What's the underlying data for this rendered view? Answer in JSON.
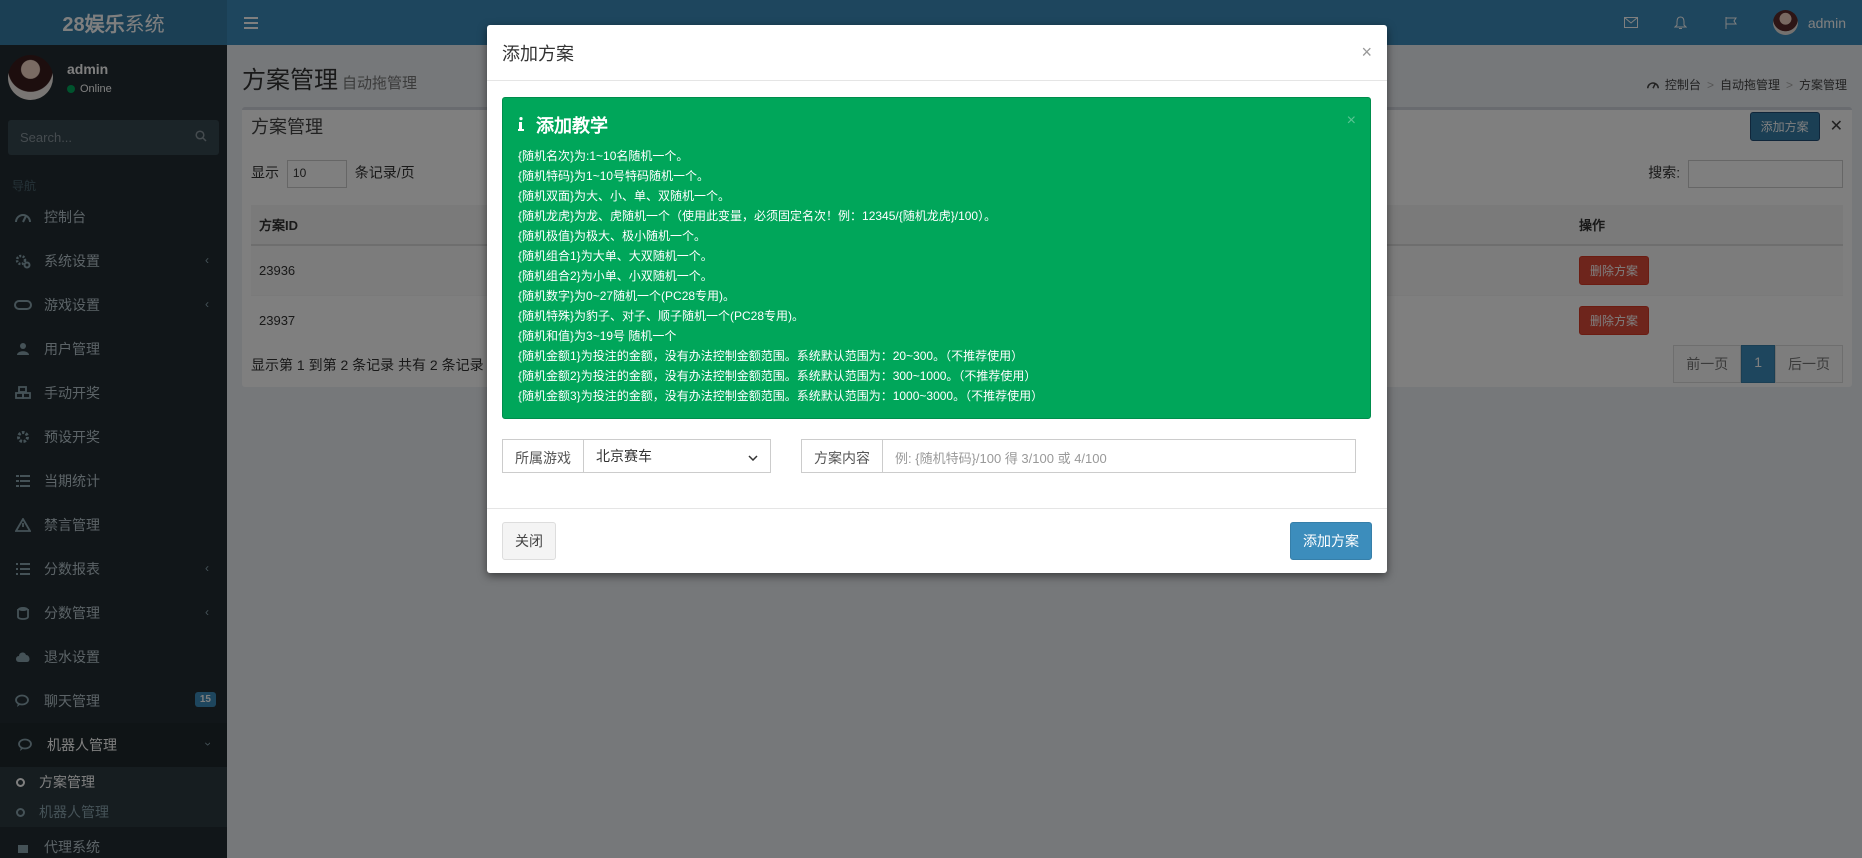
{
  "app": {
    "logo_bold": "28娱乐",
    "logo_light": "系统"
  },
  "header": {
    "username": "admin"
  },
  "sidebar": {
    "user": {
      "name": "admin",
      "status": "Online"
    },
    "search_placeholder": "Search...",
    "nav_header": "导航",
    "items": [
      {
        "label": "控制台",
        "icon": "dashboard-icon"
      },
      {
        "label": "系统设置",
        "icon": "cogs-icon"
      },
      {
        "label": "游戏设置",
        "icon": "gamepad-icon"
      },
      {
        "label": "用户管理",
        "icon": "users-icon"
      },
      {
        "label": "手动开奖",
        "icon": "cubes-icon"
      },
      {
        "label": "预设开奖",
        "icon": "gear-icon"
      },
      {
        "label": "当期统计",
        "icon": "list-icon"
      },
      {
        "label": "禁言管理",
        "icon": "warning-icon"
      },
      {
        "label": "分数报表",
        "icon": "list-ol-icon"
      },
      {
        "label": "分数管理",
        "icon": "database-icon"
      },
      {
        "label": "退水设置",
        "icon": "cloud-upload-icon"
      },
      {
        "label": "聊天管理",
        "icon": "comments-icon",
        "badge": "15"
      },
      {
        "label": "机器人管理",
        "icon": "comments-icon"
      }
    ],
    "subitems": [
      {
        "label": "方案管理"
      },
      {
        "label": "机器人管理"
      }
    ],
    "partial_item": "代理系统"
  },
  "page": {
    "title": "方案管理",
    "subtitle": "自动拖管理",
    "breadcrumb": [
      "控制台",
      "自动拖管理",
      "方案管理"
    ]
  },
  "box": {
    "title": "方案管理",
    "add_button": "添加方案",
    "show_label": "显示",
    "page_size": "10",
    "per_page_label": "条记录/页",
    "search_label": "搜索:",
    "columns": {
      "id": "方案ID",
      "action": "操作"
    },
    "rows": [
      {
        "id": "23936",
        "action": "删除方案"
      },
      {
        "id": "23937",
        "action": "删除方案"
      }
    ],
    "info": "显示第 1 到第 2 条记录 共有 2 条记录",
    "pager": {
      "prev": "前一页",
      "current": "1",
      "next": "后一页"
    }
  },
  "modal": {
    "title": "添加方案",
    "alert": {
      "title": "添加教学",
      "lines": [
        "{随机名次}为:1~10名随机一个。",
        "{随机特码}为1~10号特码随机一个。",
        "{随机双面}为大、小、单、双随机一个。",
        "{随机龙虎}为龙、虎随机一个（使用此变量，必须固定名次！例：12345/{随机龙虎}/100）。",
        "{随机极值}为极大、极小随机一个。",
        "{随机组合1}为大单、大双随机一个。",
        "{随机组合2}为小单、小双随机一个。",
        "{随机数字}为0~27随机一个(PC28专用)。",
        "{随机特殊}为豹子、对子、顺子随机一个(PC28专用)。",
        "{随机和值}为3~19号 随机一个",
        "{随机金额1}为投注的金额，没有办法控制金额范围。系统默认范围为：20~300。（不推荐使用）",
        "{随机金额2}为投注的金额，没有办法控制金额范围。系统默认范围为：300~1000。（不推荐使用）",
        "{随机金额3}为投注的金额，没有办法控制金额范围。系统默认范围为：1000~3000。（不推荐使用）"
      ]
    },
    "game_label": "所属游戏",
    "game_value": "北京赛车",
    "content_label": "方案内容",
    "content_placeholder": "例: {随机特码}/100 得 3/100 或 4/100",
    "close_button": "关闭",
    "submit_button": "添加方案"
  }
}
